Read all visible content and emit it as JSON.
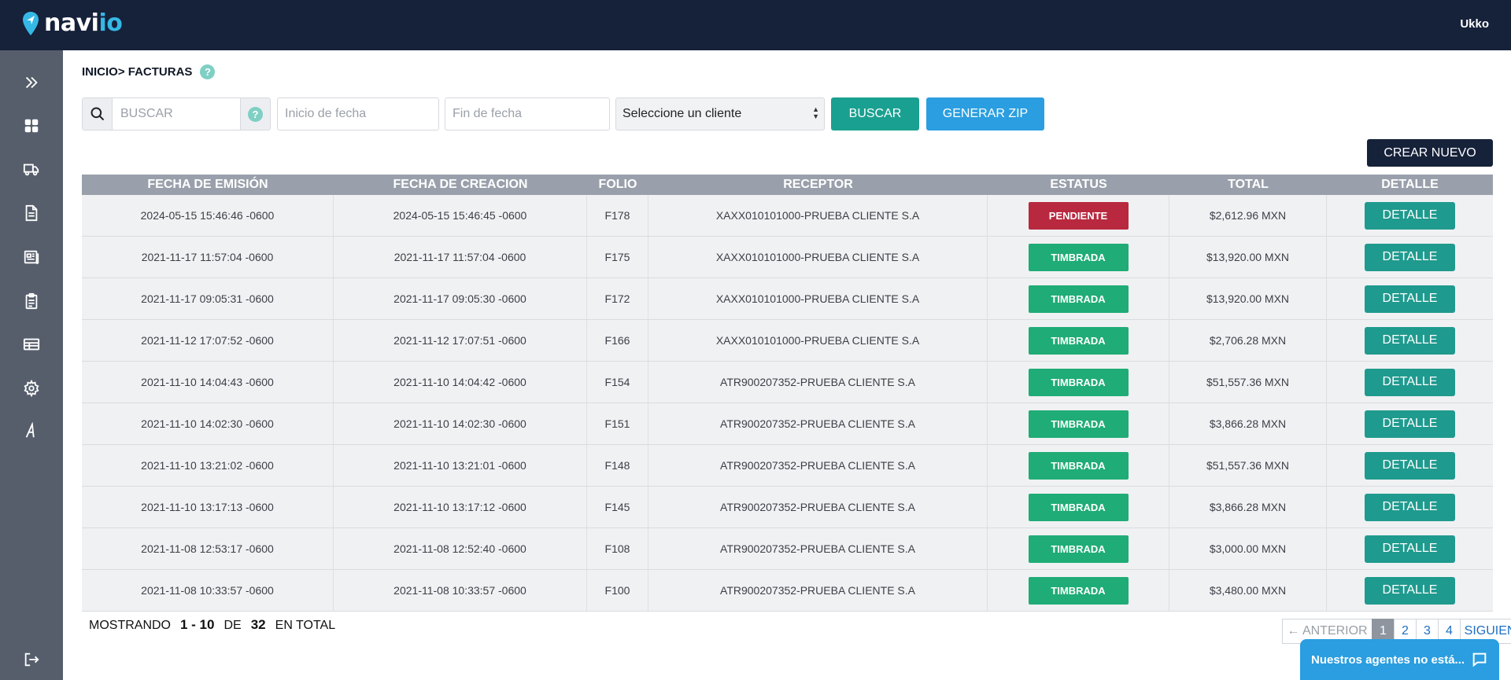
{
  "brand": {
    "name_main": "navi",
    "name_accent": "io"
  },
  "header": {
    "user": "Ukko"
  },
  "sidebar": {
    "items": [
      {
        "icon": "expand-icon"
      },
      {
        "icon": "dashboard-icon"
      },
      {
        "icon": "truck-icon"
      },
      {
        "icon": "document-icon"
      },
      {
        "icon": "newspaper-icon"
      },
      {
        "icon": "clipboard-icon"
      },
      {
        "icon": "table-icon"
      },
      {
        "icon": "gear-icon"
      },
      {
        "icon": "font-icon"
      },
      {
        "icon": "logout-icon"
      }
    ]
  },
  "breadcrumb": {
    "text": "INICIO> FACTURAS",
    "help": "?"
  },
  "filters": {
    "search_placeholder": "BUSCAR",
    "search_help": "?",
    "start_date_placeholder": "Inicio de fecha",
    "end_date_placeholder": "Fin de fecha",
    "client_select": "Seleccione un cliente",
    "search_button": "BUSCAR",
    "zip_button": "GENERAR ZIP"
  },
  "create_button": "CREAR NUEVO",
  "table": {
    "headers": [
      "FECHA DE EMISIÓN",
      "FECHA DE CREACION",
      "FOLIO",
      "RECEPTOR",
      "ESTATUS",
      "TOTAL",
      "DETALLE"
    ],
    "rows": [
      {
        "emision": "2024-05-15 15:46:46 -0600",
        "creacion": "2024-05-15 15:46:45 -0600",
        "folio": "F178",
        "receptor": "XAXX010101000-PRUEBA CLIENTE S.A",
        "estatus": "PENDIENTE",
        "total": "$2,612.96 MXN",
        "detalle": "DETALLE"
      },
      {
        "emision": "2021-11-17 11:57:04 -0600",
        "creacion": "2021-11-17 11:57:04 -0600",
        "folio": "F175",
        "receptor": "XAXX010101000-PRUEBA CLIENTE S.A",
        "estatus": "TIMBRADA",
        "total": "$13,920.00 MXN",
        "detalle": "DETALLE"
      },
      {
        "emision": "2021-11-17 09:05:31 -0600",
        "creacion": "2021-11-17 09:05:30 -0600",
        "folio": "F172",
        "receptor": "XAXX010101000-PRUEBA CLIENTE S.A",
        "estatus": "TIMBRADA",
        "total": "$13,920.00 MXN",
        "detalle": "DETALLE"
      },
      {
        "emision": "2021-11-12 17:07:52 -0600",
        "creacion": "2021-11-12 17:07:51 -0600",
        "folio": "F166",
        "receptor": "XAXX010101000-PRUEBA CLIENTE S.A",
        "estatus": "TIMBRADA",
        "total": "$2,706.28 MXN",
        "detalle": "DETALLE"
      },
      {
        "emision": "2021-11-10 14:04:43 -0600",
        "creacion": "2021-11-10 14:04:42 -0600",
        "folio": "F154",
        "receptor": "ATR900207352-PRUEBA CLIENTE S.A",
        "estatus": "TIMBRADA",
        "total": "$51,557.36 MXN",
        "detalle": "DETALLE"
      },
      {
        "emision": "2021-11-10 14:02:30 -0600",
        "creacion": "2021-11-10 14:02:30 -0600",
        "folio": "F151",
        "receptor": "ATR900207352-PRUEBA CLIENTE S.A",
        "estatus": "TIMBRADA",
        "total": "$3,866.28 MXN",
        "detalle": "DETALLE"
      },
      {
        "emision": "2021-11-10 13:21:02 -0600",
        "creacion": "2021-11-10 13:21:01 -0600",
        "folio": "F148",
        "receptor": "ATR900207352-PRUEBA CLIENTE S.A",
        "estatus": "TIMBRADA",
        "total": "$51,557.36 MXN",
        "detalle": "DETALLE"
      },
      {
        "emision": "2021-11-10 13:17:13 -0600",
        "creacion": "2021-11-10 13:17:12 -0600",
        "folio": "F145",
        "receptor": "ATR900207352-PRUEBA CLIENTE S.A",
        "estatus": "TIMBRADA",
        "total": "$3,866.28 MXN",
        "detalle": "DETALLE"
      },
      {
        "emision": "2021-11-08 12:53:17 -0600",
        "creacion": "2021-11-08 12:52:40 -0600",
        "folio": "F108",
        "receptor": "ATR900207352-PRUEBA CLIENTE S.A",
        "estatus": "TIMBRADA",
        "total": "$3,000.00 MXN",
        "detalle": "DETALLE"
      },
      {
        "emision": "2021-11-08 10:33:57 -0600",
        "creacion": "2021-11-08 10:33:57 -0600",
        "folio": "F100",
        "receptor": "ATR900207352-PRUEBA CLIENTE S.A",
        "estatus": "TIMBRADA",
        "total": "$3,480.00 MXN",
        "detalle": "DETALLE"
      }
    ]
  },
  "status_colors": {
    "PENDIENTE": "#b8293f",
    "TIMBRADA": "#1fac76"
  },
  "summary": {
    "prefix": "MOSTRANDO",
    "range": "1 - 10",
    "of": "DE",
    "total": "32",
    "suffix": "EN TOTAL"
  },
  "pagination": {
    "prev": "← ANTERIOR",
    "pages": [
      "1",
      "2",
      "3",
      "4"
    ],
    "current": "1",
    "next": "SIGUIENTE →"
  },
  "chat": {
    "label": "Nuestros agentes no está..."
  }
}
